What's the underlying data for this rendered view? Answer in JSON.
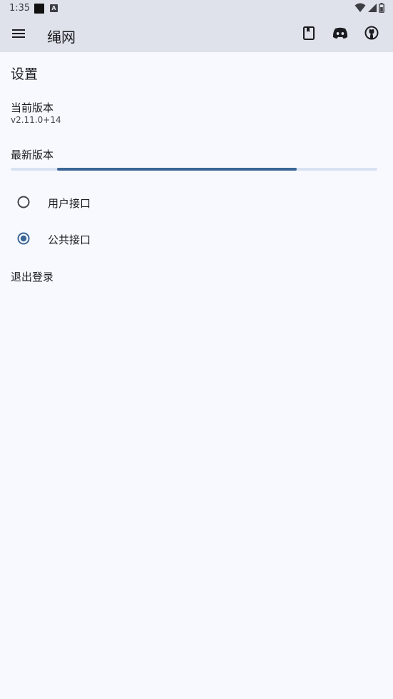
{
  "status_bar": {
    "time": "1:35",
    "icons": [
      "black-square-icon",
      "a-badge-icon",
      "wifi-icon",
      "signal-icon",
      "battery-icon"
    ]
  },
  "app_bar": {
    "title": "绳网",
    "actions": [
      "book-icon",
      "discord-icon",
      "github-icon"
    ]
  },
  "settings": {
    "title": "设置",
    "current_version_label": "当前版本",
    "current_version_value": "v2.11.0+14",
    "latest_version_label": "最新版本",
    "progress_indicator": "indeterminate",
    "api_options": [
      {
        "label": "用户接口",
        "selected": false
      },
      {
        "label": "公共接口",
        "selected": true
      }
    ],
    "logout_label": "退出登录"
  },
  "colors": {
    "accent": "#3c6696",
    "surface": "#f7f9ff",
    "app_bar": "#dfe2ea"
  }
}
